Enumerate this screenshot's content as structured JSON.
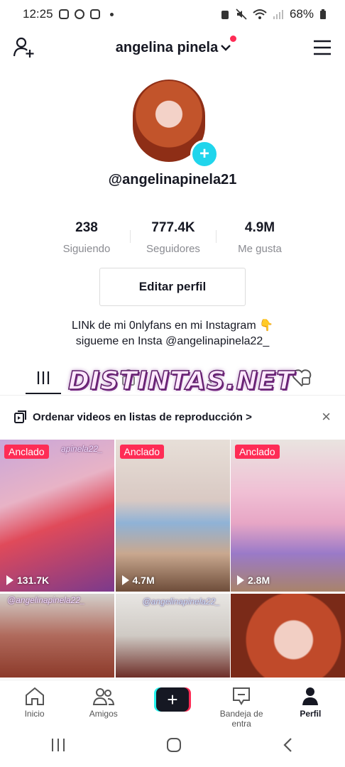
{
  "status_bar": {
    "time": "12:25",
    "battery": "68%"
  },
  "header": {
    "username": "angelina pinela"
  },
  "profile": {
    "handle": "@angelinapinela21",
    "stats": [
      {
        "value": "238",
        "label": "Siguiendo"
      },
      {
        "value": "777.4K",
        "label": "Seguidores"
      },
      {
        "value": "4.9M",
        "label": "Me gusta"
      }
    ],
    "edit_button": "Editar perfil",
    "bio_line1": "LINk de mi 0nlyfans en mi Instagram 👇",
    "bio_line2": "sigueme en Insta @angelinapinela22_"
  },
  "watermark": "DISTINTAS.NET",
  "playlist_banner": {
    "text": "Ordenar videos en listas de reproducción",
    "chevron": ">",
    "close": "×"
  },
  "videos": [
    {
      "badge": "Anclado",
      "views": "131.7K",
      "overlay": "apinela22_"
    },
    {
      "badge": "Anclado",
      "views": "4.7M"
    },
    {
      "badge": "Anclado",
      "views": "2.8M"
    },
    {
      "overlay": "@angelinapinela22_"
    },
    {
      "overlay": "@angelinapinela22_"
    },
    {}
  ],
  "bottom_nav": [
    {
      "label": "Inicio"
    },
    {
      "label": "Amigos"
    },
    {
      "label": "+"
    },
    {
      "label": "Bandeja de entra"
    },
    {
      "label": "Perfil"
    }
  ],
  "colors": {
    "accent": "#fe2c55",
    "teal": "#20d5ec",
    "text": "#161823",
    "muted": "#8a8b91"
  }
}
